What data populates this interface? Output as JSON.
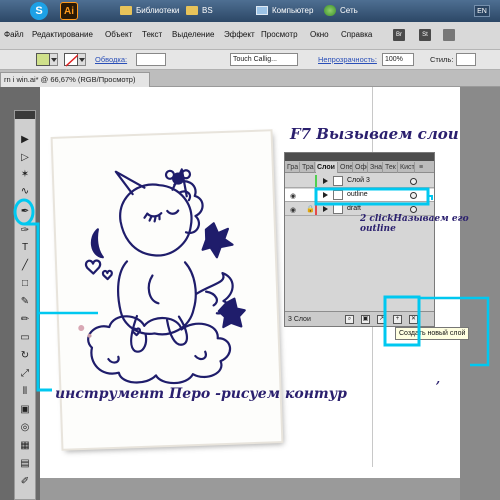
{
  "taskbar": {
    "items": [
      {
        "label": "Библиотеки"
      },
      {
        "label": "BS"
      },
      {
        "label": "Компьютер"
      },
      {
        "label": "Сеть"
      }
    ],
    "lang": "EN",
    "skype_letter": "S",
    "ai_letter": "Ai"
  },
  "menubar": {
    "items": [
      "Файл",
      "Редактирование",
      "Объект",
      "Текст",
      "Выделение",
      "Эффект",
      "Просмотр",
      "Окно",
      "Справка"
    ],
    "icons": [
      "Br",
      "St"
    ]
  },
  "controlbar": {
    "stroke_label": "Обводка:",
    "brush_value": "Touch Callig...",
    "opacity_label": "Непрозрачность:",
    "opacity_value": "100%",
    "style_label": "Стиль:"
  },
  "document": {
    "tab_title": "rn i win.ai* @ 66,67% (RGB/Просмотр)"
  },
  "layers_panel": {
    "tabs": [
      "Гра",
      "Тра",
      "Слои",
      "Опе",
      "Офо",
      "Зна",
      "Тек",
      "Кисти"
    ],
    "active_tab": "Слои",
    "layers": [
      {
        "name": "Слой 3",
        "color": "#4fcf4f",
        "visible": false,
        "locked": false,
        "selected": false
      },
      {
        "name": "outline",
        "color": "#3a7cf0",
        "visible": true,
        "locked": false,
        "selected": true
      },
      {
        "name": "draft",
        "color": "#e24b4b",
        "visible": true,
        "locked": true,
        "selected": false
      }
    ],
    "count": "3 Слои",
    "tooltip": "Создать новый слой"
  },
  "annotations": {
    "top": "F7 Вызываем слои",
    "click": "2 clickНазываем его outline",
    "bottom": "инструмент Перо -рисуем контур",
    "comma": ","
  },
  "colors": {
    "highlight": "#00c8f0",
    "annotation_ink": "#2a1f6e",
    "drawing_ink": "#1f1d6b"
  },
  "icons": {
    "tools": [
      "selection",
      "direct-selection",
      "magic-wand",
      "lasso",
      "pen",
      "curvature",
      "type",
      "line",
      "rectangle",
      "paintbrush",
      "pencil",
      "eraser",
      "rotate",
      "scale",
      "width",
      "free-transform",
      "shape-builder",
      "perspective",
      "mesh",
      "gradient",
      "eyedropper",
      "blend",
      "symbol-sprayer",
      "graph",
      "artboard"
    ]
  }
}
